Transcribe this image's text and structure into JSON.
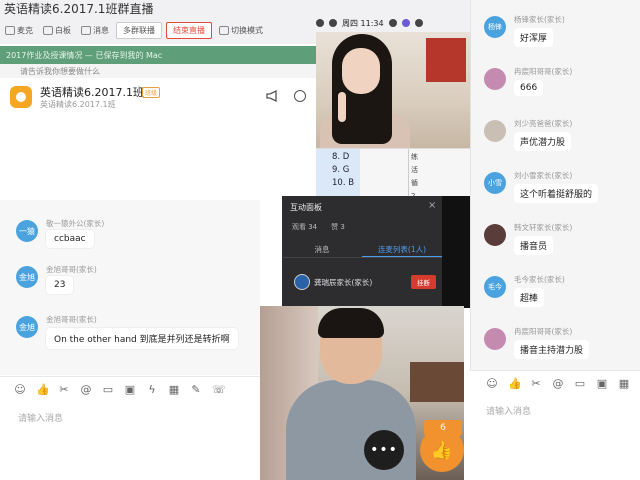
{
  "window": {
    "class_title": "英语精读6.2017.1班群直播"
  },
  "toolbar": {
    "items": [
      {
        "label": "麦克",
        "icon": "mic-icon"
      },
      {
        "label": "白板",
        "icon": "whiteboard-icon"
      },
      {
        "label": "消息",
        "icon": "message-icon"
      }
    ],
    "multi_group_label": "多群联播",
    "end_live_label": "结束直播",
    "switch_mode_label": "切换模式"
  },
  "macbar": {
    "time": "周四 11:34"
  },
  "notice": {
    "text": "2017作业及授课情况 — 已保存到我的 Mac",
    "sub_text": "请告诉我你想要做什么"
  },
  "group": {
    "title": "英语精读6.2017.1班",
    "badge": "班级",
    "subtitle": "英语精读6.2017.1班"
  },
  "left_chat": [
    {
      "avatar": "一猿",
      "name": "敬一猿外公(家长)",
      "text": "ccbaac"
    },
    {
      "avatar": "金旭",
      "name": "金旭哥哥(家长)",
      "text": "23"
    },
    {
      "avatar": "金旭",
      "name": "金旭哥哥(家长)",
      "text": "On the other hand 到底是并列还是转折啊"
    }
  ],
  "left_input": {
    "placeholder": "请输入消息"
  },
  "answer_sheet": {
    "answers": [
      "8.  D",
      "9.  G",
      "10.  B"
    ],
    "side": [
      "练",
      "活循",
      "2"
    ]
  },
  "interaction_panel": {
    "title": "互动面板",
    "viewers": "观看 34",
    "likes": "赞 3",
    "tab_messages": "消息",
    "tab_mic_list": "连麦列表(1人)",
    "mic_user": "龚瑞辰家长(家长)",
    "hangup_label": "挂断"
  },
  "student_video": {
    "more_label": "•••"
  },
  "like": {
    "count": "6"
  },
  "right_chat": [
    {
      "avatar_text": "杨锋",
      "avatar_color": "#4aa3df",
      "name": "杨锋家长(家长)",
      "text": "好浑厚"
    },
    {
      "avatar_text": "",
      "avatar_color": "#c48ab0",
      "name": "冉宸阳哥哥(家长)",
      "text": "666"
    },
    {
      "avatar_text": "",
      "avatar_color": "#c9bfb3",
      "name": "刘少亮爸爸(家长)",
      "text": "声优潜力股"
    },
    {
      "avatar_text": "小雪",
      "avatar_color": "#4aa3df",
      "name": "刘小雪家长(家长)",
      "text": "这个听着挺舒服的"
    },
    {
      "avatar_text": "",
      "avatar_color": "#5a3d3a",
      "name": "韩文轩家长(家长)",
      "text": "播音员"
    },
    {
      "avatar_text": "毛今",
      "avatar_color": "#4aa3df",
      "name": "毛今家长(家长)",
      "text": "超棒"
    },
    {
      "avatar_text": "",
      "avatar_color": "#c48ab0",
      "name": "冉宸阳哥哥(家长)",
      "text": "播音主持潜力股"
    }
  ],
  "right_input": {
    "placeholder": "请输入消息"
  },
  "colors": {
    "accent_blue": "#4aa3df",
    "notice_green": "#5e9e78",
    "danger_red": "#e64a3b",
    "like_orange": "#f2922e"
  }
}
